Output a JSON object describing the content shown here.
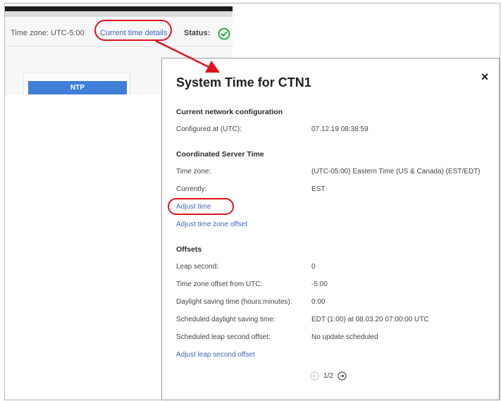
{
  "background": {
    "timezone_text": "Time zone: UTC-5:00",
    "link_current_time_details": "Current time details",
    "status_label": "Status:",
    "ntp_button": "NTP",
    "colors": {
      "link": "#3f66c2",
      "status_ok": "#1fa33c",
      "ntp": "#3f7fd8",
      "callout": "#e0121c"
    }
  },
  "dialog": {
    "title": "System Time for CTN1",
    "close_symbol": "×",
    "current_network_configuration": {
      "heading": "Current network configuration",
      "configured_at_label": "Configured at (UTC):",
      "configured_at_value": "07.12.19 08:38:59"
    },
    "coordinated_server_time": {
      "heading": "Coordinated Server Time",
      "time_zone_label": "Time zone:",
      "time_zone_value": "(UTC-05:00) Eastern Time (US & Canada) (EST/EDT)",
      "currently_label": "Currently:",
      "currently_value": "EST",
      "adjust_time_link": "Adjust time",
      "adjust_tz_offset_link": "Adjust time zone offset"
    },
    "offsets": {
      "heading": "Offsets",
      "leap_second_label": "Leap second:",
      "leap_second_value": "0",
      "tz_offset_label": "Time zone offset from UTC:",
      "tz_offset_value": "-5:00",
      "dst_label": "Daylight saving time (hours:minutes):",
      "dst_value": "0:00",
      "scheduled_dst_label": "Scheduled daylight saving time:",
      "scheduled_dst_value": "EDT (1:00) at 08.03.20 07:00:00 UTC",
      "scheduled_leap_label": "Scheduled leap second offset:",
      "scheduled_leap_value": "No update scheduled",
      "adjust_leap_link": "Adjust leap second offset"
    },
    "pagination": {
      "text": "1/2",
      "current_page": 1,
      "total_pages": 2
    }
  }
}
